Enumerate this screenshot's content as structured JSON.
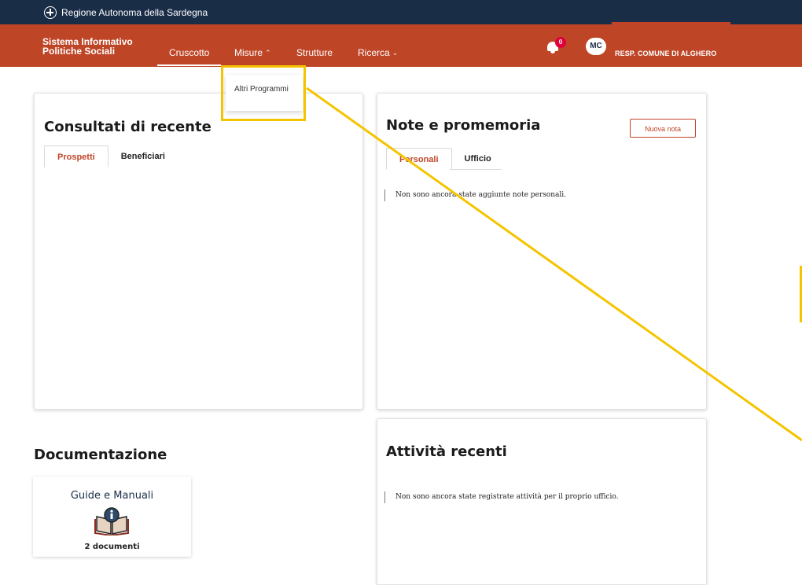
{
  "topbar": {
    "brand": "Regione Autonoma della Sardegna"
  },
  "navbar": {
    "system_name_line1": "Sistema Informativo",
    "system_name_line2": "Politiche Sociali",
    "items": [
      {
        "label": "Cruscotto"
      },
      {
        "label": "Misure"
      },
      {
        "label": "Strutture"
      },
      {
        "label": "Ricerca"
      }
    ],
    "notifications_count": "0",
    "avatar_initials": "MC",
    "role": "RESP. COMUNE DI ALGHERO"
  },
  "dropdown": {
    "option": "Altri Programmi"
  },
  "recent": {
    "title": "Consultati di recente",
    "tabs": [
      "Prospetti",
      "Beneficiari"
    ]
  },
  "notes": {
    "title": "Note e promemoria",
    "new_button": "Nuova nota",
    "tabs": [
      "Personali",
      "Ufficio"
    ],
    "empty_message": "Non sono ancora state aggiunte note personali."
  },
  "documentation": {
    "title": "Documentazione",
    "card_title": "Guide e Manuali",
    "card_count": "2 documenti"
  },
  "activities": {
    "title": "Attività recenti",
    "empty_message": "Non sono ancora state registrate attività per il proprio ufficio."
  },
  "colors": {
    "navy": "#1a2d47",
    "brand": "#bf4527",
    "annotation": "#f5c400"
  }
}
